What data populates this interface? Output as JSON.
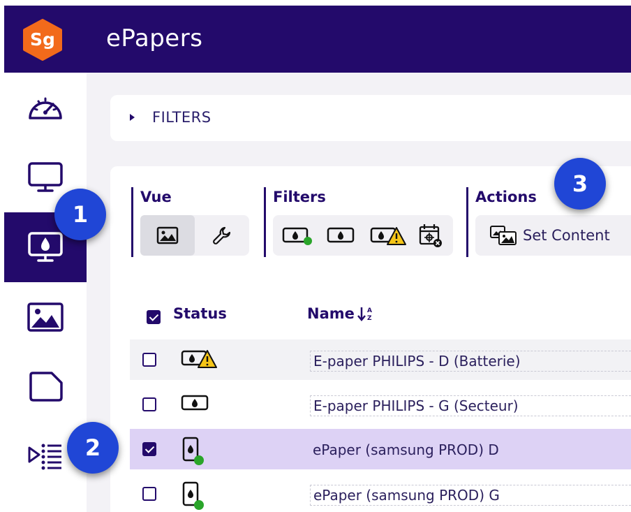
{
  "header": {
    "logo_text": "Sg",
    "title": "ePapers"
  },
  "sidebar": {
    "items": [
      {
        "icon": "dashboard-icon"
      },
      {
        "icon": "monitor-icon"
      },
      {
        "icon": "epaper-monitor-icon",
        "active": true
      },
      {
        "icon": "image-icon"
      },
      {
        "icon": "document-icon"
      },
      {
        "icon": "playlist-icon"
      }
    ]
  },
  "filters_bar": {
    "label": "FILTERS"
  },
  "toolbar": {
    "vue": {
      "title": "Vue"
    },
    "filters": {
      "title": "Filters"
    },
    "actions": {
      "title": "Actions",
      "set_content_label": "Set Content"
    }
  },
  "badges": {
    "one": "1",
    "two": "2",
    "three": "3"
  },
  "table": {
    "headers": {
      "status": "Status",
      "name": "Name"
    },
    "rows": [
      {
        "name": "E-paper PHILIPS - D (Batterie)",
        "status": "warning",
        "checked": false
      },
      {
        "name": "E-paper PHILIPS - G (Secteur)",
        "status": "offline",
        "checked": false
      },
      {
        "name": "ePaper (samsung PROD) D",
        "status": "online",
        "checked": true
      },
      {
        "name": "ePaper (samsung PROD) G",
        "status": "online",
        "checked": false
      }
    ]
  },
  "colors": {
    "brand": "#230a6b",
    "logo": "#f26a1b",
    "badge": "#2046d6",
    "online": "#2aa52a",
    "warning": "#f5c518",
    "selected_row": "#ddd2f5"
  }
}
